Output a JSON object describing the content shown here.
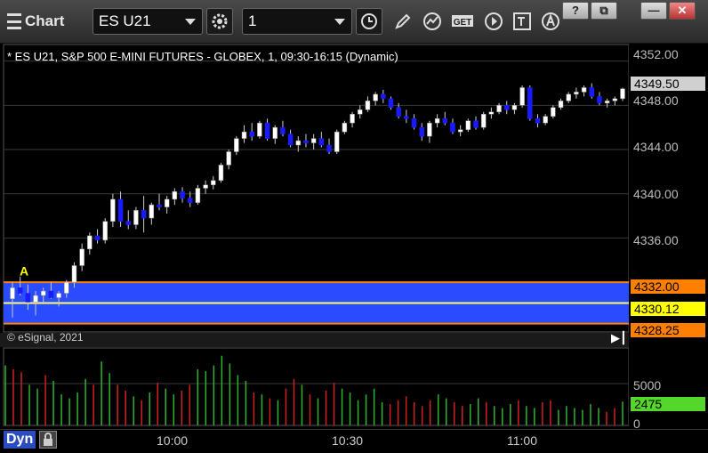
{
  "toolbar": {
    "app_title": "Chart",
    "symbol": "ES U21",
    "interval": "1",
    "icons": [
      "refresh-gear-icon",
      "clock-icon",
      "pencil-icon",
      "study-icon",
      "get-icon",
      "play-icon",
      "text-tool-icon",
      "alert-icon"
    ],
    "window_buttons": {
      "help": "?",
      "restore": "⧉",
      "minimize": "—",
      "close": "✕"
    }
  },
  "chart": {
    "header": "* ES U21, S&P 500 E-MINI FUTURES - GLOBEX, 1, 09:30-16:15 (Dynamic)",
    "copyright": "© eSignal, 2021",
    "price_axis": [
      "4352.00",
      "4348.00",
      "4344.00",
      "4340.00",
      "4336.00"
    ],
    "volume_axis": [
      "5000",
      "0"
    ],
    "time_axis": [
      "10:00",
      "10:30",
      "11:00"
    ],
    "price_tags": {
      "last": "4349.50",
      "upper": "4332.00",
      "mid": "4330.12",
      "lower": "4328.25",
      "volume": "2475"
    },
    "mode_tag": "Dyn",
    "marker": "A",
    "colors": {
      "up": "#ffffff",
      "down": "#1a1aff",
      "band_fill": "#2a4cff",
      "band_edge": "#ff8000",
      "mid_line": "#ffff66",
      "vol_up": "#2db52d",
      "vol_down": "#d02020",
      "volume_tag": "#55d62a"
    }
  },
  "chart_data": {
    "type": "bar",
    "title": "* ES U21, S&P 500 E-MINI FUTURES - GLOBEX, 1, 09:30-16:15 (Dynamic)",
    "xlabel": "",
    "ylabel": "",
    "ylim": [
      4327.5,
      4353.5
    ],
    "time_ticks": [
      "10:00",
      "10:30",
      "11:00"
    ],
    "candles_ohlc": [
      [
        4330.5,
        4332,
        4328.8,
        4331.5
      ],
      [
        4331.5,
        4332.5,
        4330.8,
        4331.0
      ],
      [
        4331.0,
        4331.8,
        4329.5,
        4330.2
      ],
      [
        4330.2,
        4331.2,
        4329.0,
        4330.8
      ],
      [
        4330.8,
        4331.5,
        4330.0,
        4331.2
      ],
      [
        4331.2,
        4332.0,
        4330.5,
        4330.6
      ],
      [
        4330.6,
        4331.2,
        4329.8,
        4331.0
      ],
      [
        4331.0,
        4332.2,
        4330.6,
        4332.0
      ],
      [
        4332.0,
        4333.8,
        4331.5,
        4333.5
      ],
      [
        4333.5,
        4335.5,
        4333.0,
        4335.0
      ],
      [
        4335.0,
        4336.5,
        4334.5,
        4336.2
      ],
      [
        4336.2,
        4336.8,
        4335.5,
        4335.8
      ],
      [
        4335.8,
        4337.8,
        4335.5,
        4337.5
      ],
      [
        4337.5,
        4340.0,
        4337.0,
        4339.5
      ],
      [
        4339.5,
        4340.2,
        4337.0,
        4337.5
      ],
      [
        4337.5,
        4338.5,
        4336.8,
        4337.2
      ],
      [
        4337.2,
        4338.8,
        4336.8,
        4338.5
      ],
      [
        4338.5,
        4339.8,
        4336.5,
        4337.8
      ],
      [
        4337.8,
        4339.2,
        4337.2,
        4339.0
      ],
      [
        4339.0,
        4340.0,
        4338.5,
        4338.8
      ],
      [
        4338.8,
        4339.8,
        4338.2,
        4339.5
      ],
      [
        4339.5,
        4340.5,
        4339.0,
        4340.2
      ],
      [
        4340.2,
        4340.6,
        4339.2,
        4339.6
      ],
      [
        4339.6,
        4340.2,
        4338.8,
        4339.2
      ],
      [
        4339.2,
        4340.8,
        4339.0,
        4340.5
      ],
      [
        4340.5,
        4341.2,
        4340.0,
        4340.8
      ],
      [
        4340.8,
        4341.6,
        4340.4,
        4341.2
      ],
      [
        4341.2,
        4342.8,
        4341.0,
        4342.6
      ],
      [
        4342.6,
        4344.0,
        4342.2,
        4343.8
      ],
      [
        4343.8,
        4345.2,
        4343.5,
        4345.0
      ],
      [
        4345.0,
        4346.2,
        4344.6,
        4345.6
      ],
      [
        4345.6,
        4346.4,
        4344.8,
        4345.2
      ],
      [
        4345.2,
        4346.6,
        4345.0,
        4346.4
      ],
      [
        4346.4,
        4346.8,
        4344.8,
        4345.0
      ],
      [
        4345.0,
        4346.2,
        4344.5,
        4346.0
      ],
      [
        4346.0,
        4346.6,
        4345.2,
        4345.4
      ],
      [
        4345.4,
        4345.8,
        4344.2,
        4344.4
      ],
      [
        4344.4,
        4345.2,
        4343.8,
        4344.8
      ],
      [
        4344.8,
        4345.4,
        4344.2,
        4344.6
      ],
      [
        4344.6,
        4345.4,
        4344.0,
        4345.0
      ],
      [
        4345.0,
        4345.6,
        4344.2,
        4344.4
      ],
      [
        4344.4,
        4345.0,
        4343.6,
        4343.8
      ],
      [
        4343.8,
        4345.8,
        4343.6,
        4345.6
      ],
      [
        4345.6,
        4346.6,
        4345.4,
        4346.4
      ],
      [
        4346.4,
        4347.4,
        4346.0,
        4347.2
      ],
      [
        4347.2,
        4348.0,
        4346.8,
        4347.6
      ],
      [
        4347.6,
        4348.8,
        4347.4,
        4348.4
      ],
      [
        4348.4,
        4349.2,
        4348.0,
        4349.0
      ],
      [
        4349.0,
        4349.4,
        4348.2,
        4348.6
      ],
      [
        4348.6,
        4348.8,
        4347.6,
        4347.8
      ],
      [
        4347.8,
        4348.2,
        4346.8,
        4347.0
      ],
      [
        4347.0,
        4347.6,
        4346.4,
        4346.8
      ],
      [
        4346.8,
        4347.2,
        4345.8,
        4346.0
      ],
      [
        4346.0,
        4346.4,
        4344.8,
        4345.2
      ],
      [
        4345.2,
        4346.6,
        4344.6,
        4346.4
      ],
      [
        4346.4,
        4347.2,
        4346.0,
        4346.8
      ],
      [
        4346.8,
        4347.4,
        4346.2,
        4346.4
      ],
      [
        4346.4,
        4346.8,
        4345.4,
        4345.6
      ],
      [
        4345.6,
        4346.2,
        4345.2,
        4345.8
      ],
      [
        4345.8,
        4346.8,
        4345.6,
        4346.6
      ],
      [
        4346.6,
        4347.0,
        4345.8,
        4346.0
      ],
      [
        4346.0,
        4347.4,
        4345.8,
        4347.2
      ],
      [
        4347.2,
        4347.8,
        4346.8,
        4347.4
      ],
      [
        4347.4,
        4348.2,
        4347.2,
        4348.0
      ],
      [
        4348.0,
        4348.4,
        4347.2,
        4347.6
      ],
      [
        4347.6,
        4348.2,
        4347.2,
        4348.0
      ],
      [
        4348.0,
        4349.8,
        4347.8,
        4349.6
      ],
      [
        4349.6,
        4349.8,
        4346.6,
        4346.8
      ],
      [
        4346.8,
        4347.2,
        4346.0,
        4346.4
      ],
      [
        4346.4,
        4347.2,
        4346.2,
        4347.0
      ],
      [
        4347.0,
        4348.0,
        4346.8,
        4347.8
      ],
      [
        4347.8,
        4348.6,
        4347.6,
        4348.4
      ],
      [
        4348.4,
        4349.2,
        4348.2,
        4349.0
      ],
      [
        4349.0,
        4349.6,
        4348.6,
        4349.2
      ],
      [
        4349.2,
        4349.8,
        4348.8,
        4349.6
      ],
      [
        4349.6,
        4350.0,
        4348.6,
        4348.8
      ],
      [
        4348.8,
        4349.2,
        4348.0,
        4348.2
      ],
      [
        4348.2,
        4348.6,
        4347.8,
        4348.4
      ],
      [
        4348.4,
        4348.8,
        4348.0,
        4348.6
      ],
      [
        4348.6,
        4349.6,
        4348.4,
        4349.5
      ]
    ],
    "volume_ylim": [
      0,
      8000
    ],
    "volume": [
      6200,
      5800,
      5500,
      4200,
      3800,
      5200,
      4600,
      3200,
      2800,
      3400,
      4800,
      4200,
      6600,
      5400,
      4200,
      3600,
      3000,
      2600,
      3400,
      4400,
      3800,
      3200,
      3600,
      4200,
      5800,
      5600,
      6200,
      7200,
      6400,
      5200,
      4600,
      3400,
      3200,
      2800,
      2600,
      3800,
      4800,
      4200,
      3200,
      2800,
      3600,
      4400,
      3800,
      3400,
      2600,
      3200,
      3800,
      2400,
      2200,
      2600,
      3000,
      2400,
      2000,
      2600,
      3200,
      2800,
      2400,
      2000,
      2200,
      2800,
      2400,
      2000,
      1800,
      2200,
      2600,
      2000,
      1800,
      2400,
      2600,
      1600,
      2000,
      1800,
      1600,
      2200,
      1800,
      1400,
      1800,
      2475
    ]
  }
}
